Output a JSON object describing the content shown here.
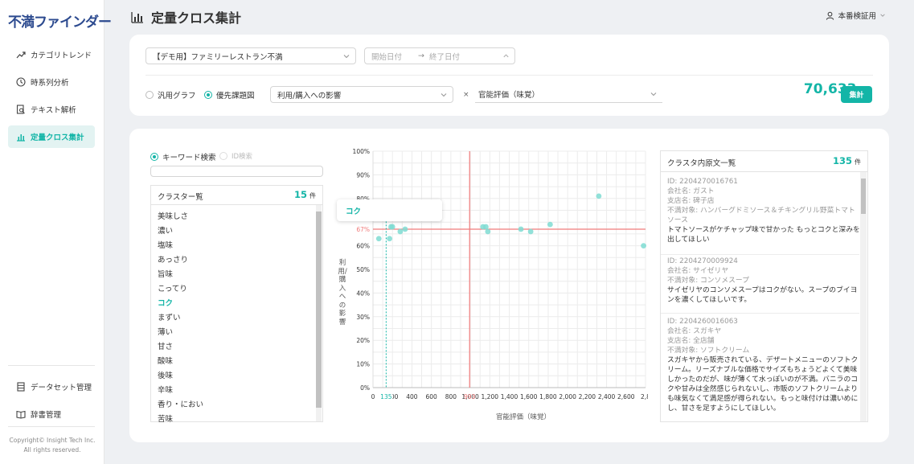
{
  "app": {
    "logo": "不満ファインダー",
    "copyright_line1": "Copyright© Insight Tech Inc.",
    "copyright_line2": "All rights reserved."
  },
  "sidebar": {
    "items": [
      {
        "label": "カテゴリトレンド",
        "icon": "trend-icon"
      },
      {
        "label": "時系列分析",
        "icon": "clock-icon"
      },
      {
        "label": "テキスト解析",
        "icon": "document-search-icon"
      },
      {
        "label": "定量クロス集計",
        "icon": "bar-chart-icon",
        "active": true
      }
    ],
    "bottom_items": [
      {
        "label": "データセット管理",
        "icon": "database-icon"
      },
      {
        "label": "辞書管理",
        "icon": "book-icon"
      }
    ]
  },
  "header": {
    "title": "定量クロス集計",
    "user": "本番検証用"
  },
  "filters": {
    "dataset": "【デモ用】ファミリーレストラン不満",
    "start_placeholder": "開始日付",
    "arrow": "→",
    "end_placeholder": "終了日付",
    "total_count": "70,633",
    "total_unit": "件",
    "mode_general": "汎用グラフ",
    "mode_priority": "優先課題図",
    "y_axis_select": "利用/購入への影響",
    "cross": "×",
    "x_axis_select": "官能評価（味覚）",
    "aggregate_button": "集計"
  },
  "search": {
    "keyword_label": "キーワード検索",
    "id_label": "ID検索",
    "value": ""
  },
  "clusters": {
    "title": "クラスター覧",
    "count": "15",
    "unit": "件",
    "selected": "コク",
    "items": [
      "美味しさ",
      "濃い",
      "塩味",
      "あっさり",
      "旨味",
      "こってり",
      "コク",
      "まずい",
      "薄い",
      "甘さ",
      "酸味",
      "後味",
      "辛味",
      "香り・におい",
      "苦味"
    ]
  },
  "chart_data": {
    "type": "scatter",
    "ylabel": "利用/購入への影響",
    "xlabel": "官能評価（味覚）",
    "yticks": [
      "0%",
      "10%",
      "20%",
      "30%",
      "40%",
      "50%",
      "60%",
      "70%",
      "80%",
      "90%",
      "100%"
    ],
    "xticks": [
      "0",
      "200",
      "400",
      "600",
      "800",
      "1,000",
      "1,200",
      "1,400",
      "1,600",
      "1,800",
      "2,000",
      "2,200",
      "2,400",
      "2,600",
      "2,8"
    ],
    "xlim": [
      0,
      2800
    ],
    "ylim": [
      0,
      100
    ],
    "ref_x_label": "993",
    "ref_y_label": "67%",
    "ref_x": 993,
    "ref_y": 67,
    "highlight": {
      "name": "コク",
      "x": 135,
      "y": 73,
      "x_label": "135",
      "y_label": "73%"
    },
    "points": [
      {
        "x": 60,
        "y": 63
      },
      {
        "x": 135,
        "y": 73
      },
      {
        "x": 170,
        "y": 63
      },
      {
        "x": 185,
        "y": 68
      },
      {
        "x": 200,
        "y": 68
      },
      {
        "x": 280,
        "y": 66
      },
      {
        "x": 330,
        "y": 67
      },
      {
        "x": 1130,
        "y": 68
      },
      {
        "x": 1160,
        "y": 68
      },
      {
        "x": 1180,
        "y": 66
      },
      {
        "x": 1520,
        "y": 67
      },
      {
        "x": 1620,
        "y": 66
      },
      {
        "x": 1820,
        "y": 69
      },
      {
        "x": 2320,
        "y": 81
      },
      {
        "x": 2780,
        "y": 60
      }
    ]
  },
  "docs": {
    "title": "クラスタ内原文一覧",
    "count": "135",
    "unit": "件",
    "items": [
      {
        "id": "ID: 2204270016761",
        "company": "会社名: ガスト",
        "store": "支店名: 碑子店",
        "target": "不満対象: ハンバーグドミソース＆チキングリル野菜トマトソース",
        "text": "トマトソースがケチャップ味で甘かった もっとコクと深みを出してほしい"
      },
      {
        "id": "ID: 2204270009924",
        "company": "会社名: サイゼリヤ",
        "target": "不満対象: コンソメスープ",
        "text": "サイゼリヤのコンソメスープはコクがない。スープのブイヨンを濃くしてほしいです。"
      },
      {
        "id": "ID: 2204260016063",
        "company": "会社名: スガキヤ",
        "store": "支店名: 全店舗",
        "target": "不満対象: ソフトクリーム",
        "text": "スガキヤから販売されている、デザートメニューのソフトクリーム。リーズナブルな価格でサイズもちょうどよくて美味しかったのだが、味が薄くて水っぽいのが不満。バニラのコクや甘みは全然感じられないし、市販のソフトクリームよりも味気なくて満足感が得られない。もっと味付けは濃いめにし、甘さを足すようにしてほしい。"
      }
    ]
  },
  "colors": {
    "accent": "#13b5a7",
    "ref_line": "#f07b7b",
    "logo": "#2c4a8f"
  }
}
